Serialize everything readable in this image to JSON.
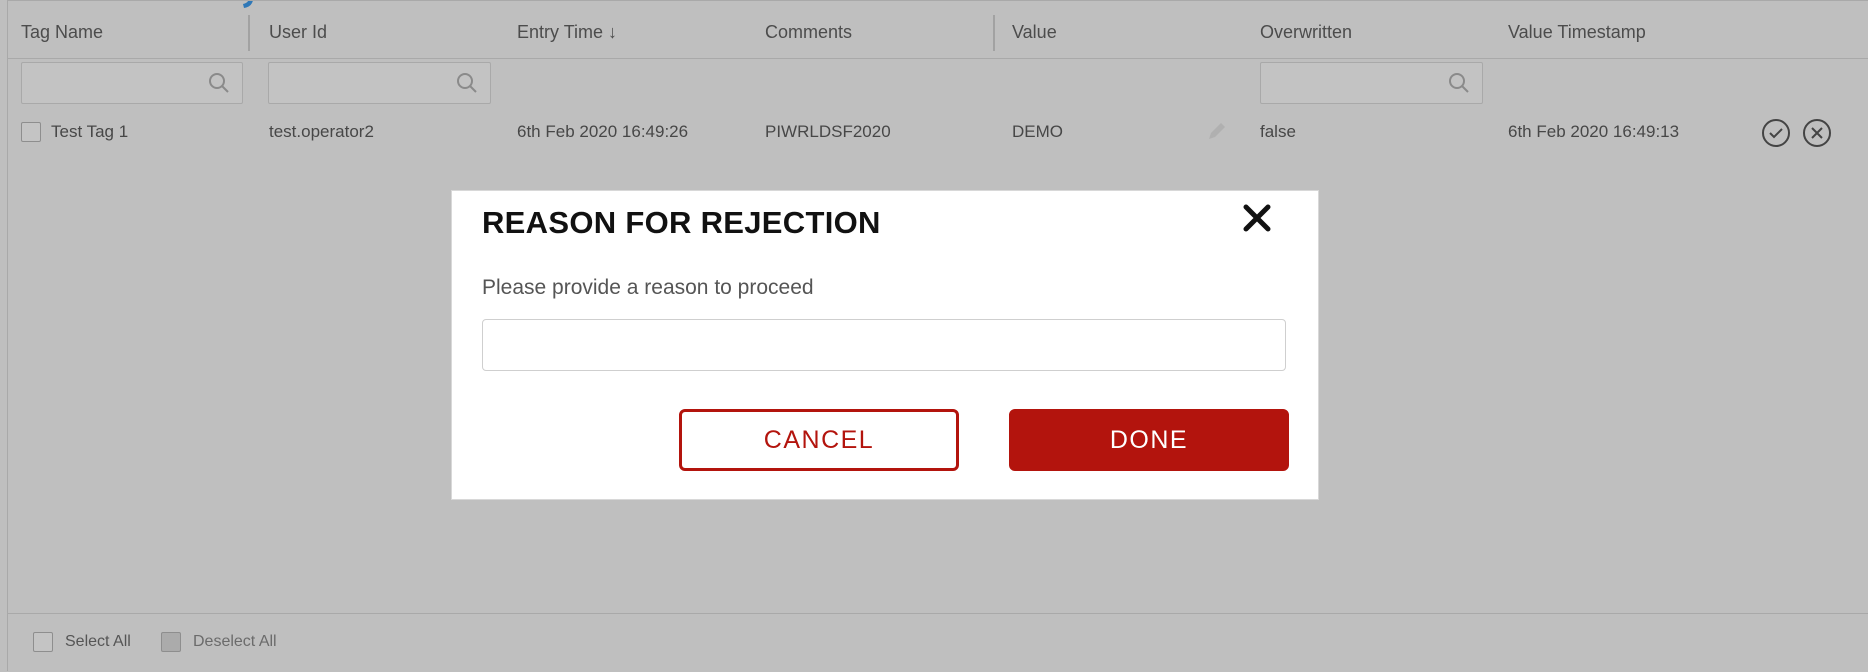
{
  "table": {
    "columns": [
      {
        "label": "Tag Name"
      },
      {
        "label": "User Id"
      },
      {
        "label": "Entry Time"
      },
      {
        "label": "Comments"
      },
      {
        "label": "Value"
      },
      {
        "label": "Overwritten"
      },
      {
        "label": "Value Timestamp"
      }
    ],
    "sort_indicator": "↓",
    "rows": [
      {
        "tag_name": "Test Tag 1",
        "user_id": "test.operator2",
        "entry_time": "6th Feb 2020 16:49:26",
        "comments": "PIWRLDSF2020",
        "value": "DEMO",
        "overwritten": "false",
        "value_timestamp": "6th Feb 2020 16:49:13"
      }
    ]
  },
  "footer": {
    "select_all": "Select All",
    "deselect_all": "Deselect All"
  },
  "modal": {
    "title": "REASON FOR REJECTION",
    "subtitle": "Please provide a reason to proceed",
    "input_value": "",
    "input_placeholder": "",
    "cancel_label": "CANCEL",
    "done_label": "DONE"
  },
  "colors": {
    "overlay_gray": "#bfbfbf",
    "accent_red": "#b3140d",
    "partial_title_blue": "#2f78b7"
  },
  "icons": {
    "filter": "search-icon",
    "edit": "pencil-icon",
    "approve": "check-circle-icon",
    "reject": "x-circle-icon",
    "close": "close-icon"
  }
}
